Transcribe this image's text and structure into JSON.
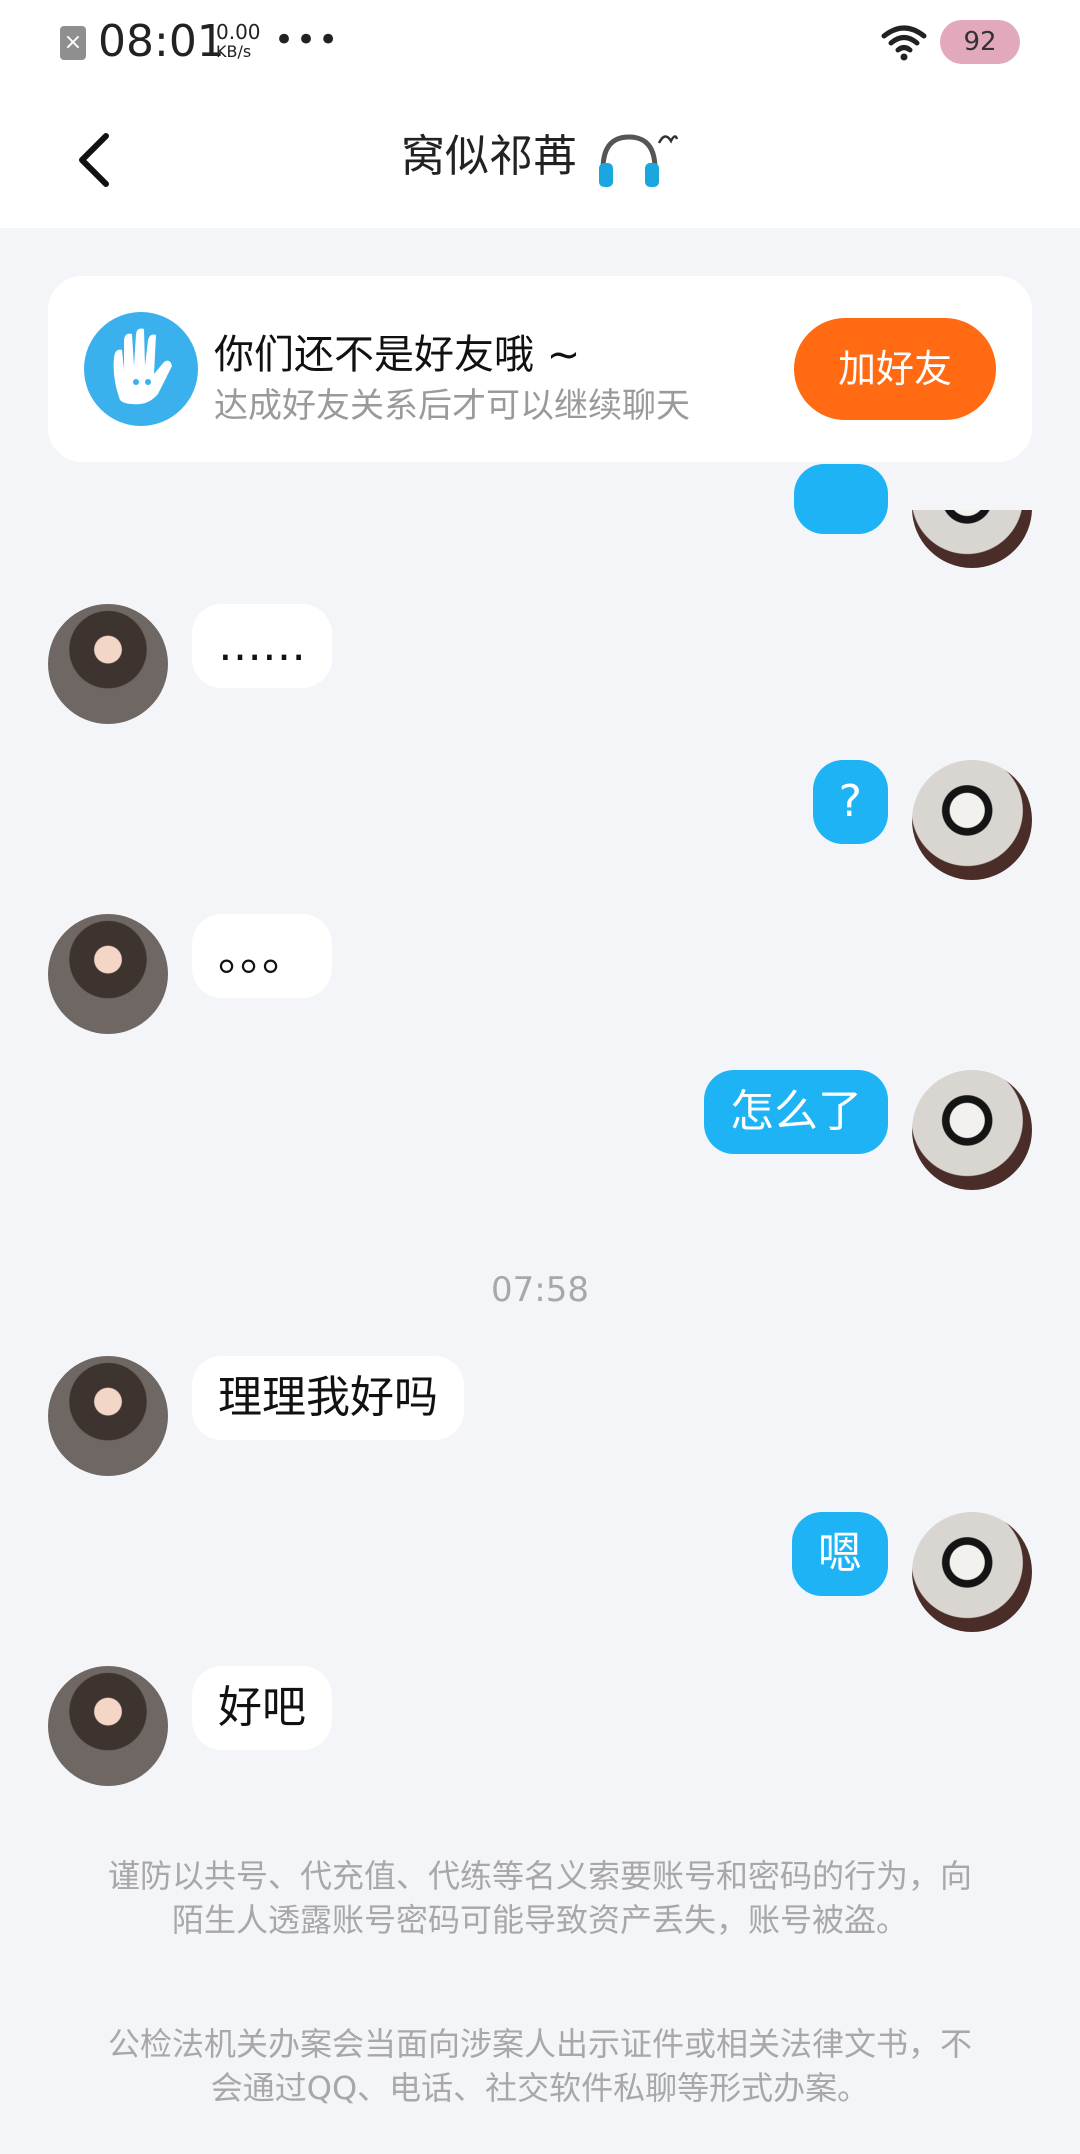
{
  "status_bar": {
    "time": "08:01",
    "speed_value": "0.00",
    "speed_unit": "KB/s",
    "more": "•••",
    "battery": "92"
  },
  "header": {
    "title": "窝似祁苒"
  },
  "friend_card": {
    "title": "你们还不是好友哦 ~",
    "subtitle": "达成好友关系后才可以继续聊天",
    "button": "加好友"
  },
  "messages": [
    {
      "side": "left",
      "text": "……"
    },
    {
      "side": "right",
      "text": "?"
    },
    {
      "side": "left",
      "text": "。。。"
    },
    {
      "side": "right",
      "text": "怎么了"
    },
    {
      "side": "left",
      "text": "理理我好吗"
    },
    {
      "side": "right",
      "text": "嗯"
    },
    {
      "side": "left",
      "text": "好吧"
    }
  ],
  "timestamp": "07:58",
  "notices": [
    "谨防以共号、代充值、代练等名义索要账号和密码的行为，向陌生人透露账号密码可能导致资产丢失，账号被盗。",
    "公检法机关办案会当面向涉案人出示证件或相关法律文书，不会通过QQ、电话、社交软件私聊等形式办案。"
  ],
  "colors": {
    "accent_blue": "#1eb3f5",
    "add_button": "#ff6a13",
    "background": "#f3f5f8",
    "battery": "#e2a9bd"
  }
}
